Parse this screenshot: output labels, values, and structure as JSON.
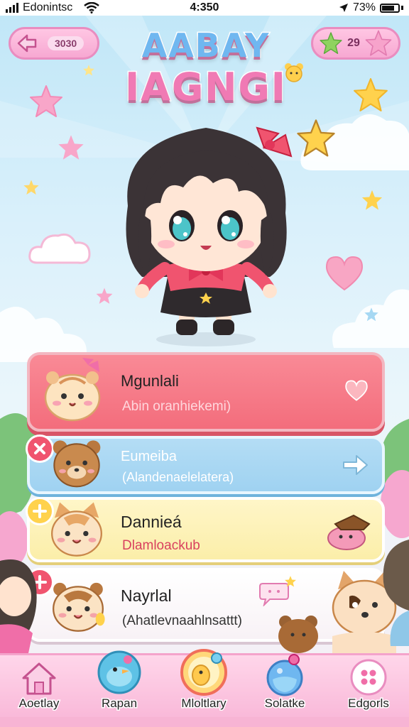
{
  "status_bar": {
    "carrier": "Edonintsc",
    "time": "4:350",
    "battery": "73%"
  },
  "header": {
    "back_label": "3030",
    "star_count": "29"
  },
  "title": {
    "line1": "AABAY",
    "line2": "IAGNGI"
  },
  "cards": [
    {
      "title": "Mgunlali",
      "subtitle": "Abin oranhiekemi)",
      "action_icon": "heart-icon",
      "subtitle_color": "#ffd6dc"
    },
    {
      "title": "Eumeiba",
      "subtitle": "(Alandenaelelatera)",
      "action_icon": "arrow-right-icon",
      "subtitle_color": "#ffffff"
    },
    {
      "title": "Dannieá",
      "subtitle": "Dlamloackub",
      "action_icon": "pet-bed-icon",
      "subtitle_color": "#d9415f"
    },
    {
      "title": "Nayrlal",
      "subtitle": "(Ahatlevnaahlnsattt)",
      "action_icon": "speech-bubble-icon",
      "subtitle_color": "#333333"
    }
  ],
  "bottom_nav": [
    {
      "label": "Aoetlay",
      "icon": "home-icon"
    },
    {
      "label": "Rapan",
      "icon": "bird-icon"
    },
    {
      "label": "Mloltlary",
      "icon": "pet-ring-icon"
    },
    {
      "label": "Solatke",
      "icon": "potion-icon"
    },
    {
      "label": "Edgorls",
      "icon": "grid-dots-icon"
    }
  ],
  "colors": {
    "accent_pink": "#f07ab4",
    "accent_blue": "#6fb7f0",
    "card_red": "#f36d7c",
    "card_blue": "#9fd2f1",
    "card_yellow": "#fbeea9",
    "card_white": "#ffffff"
  }
}
